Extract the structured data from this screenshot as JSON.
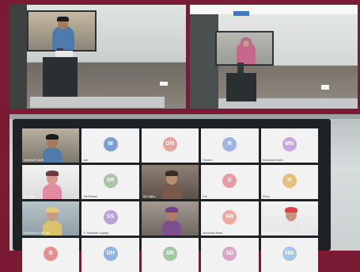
{
  "participants": [
    {
      "name": "MUHAJIR ALIM",
      "initials": "",
      "color": "",
      "video": true
    },
    {
      "name": "ann",
      "initials": "W",
      "color": "#7b9fd0",
      "video": false
    },
    {
      "name": "",
      "initials": "DM",
      "color": "#e8a39b",
      "video": false
    },
    {
      "name": "Romeo",
      "initials": "R",
      "color": "#9fb4e3",
      "video": false
    },
    {
      "name": "Muhd Amir Amin",
      "initials": "MN",
      "color": "#c6a7dc",
      "video": false
    },
    {
      "name": "Siti Hajar",
      "initials": "",
      "color": "",
      "video": true
    },
    {
      "name": "Siti Rohani",
      "initials": "SR",
      "color": "#aac4a6",
      "video": false
    },
    {
      "name": "Siti Jaliha",
      "initials": "",
      "color": "",
      "video": true
    },
    {
      "name": "Edi",
      "initials": "E",
      "color": "#e89aa2",
      "video": false
    },
    {
      "name": "Siti ai",
      "initials": "H",
      "color": "#e5c07b",
      "video": false
    },
    {
      "name": "NORAJIDA CHE MA",
      "initials": "",
      "color": "",
      "video": true
    },
    {
      "name": "S. Sabariah Supriyo",
      "initials": "SS",
      "color": "#b7a4d6",
      "video": false
    },
    {
      "name": "",
      "initials": "",
      "color": "",
      "video": true
    },
    {
      "name": "Noorniela Raha",
      "initials": "NR",
      "color": "#f0a7a1",
      "video": false
    },
    {
      "name": "NORHAFZA AMIR",
      "initials": "",
      "color": "",
      "video": true
    },
    {
      "name": "",
      "initials": "B",
      "color": "#e88e8e",
      "video": false
    },
    {
      "name": "",
      "initials": "DH",
      "color": "#8fb4e0",
      "video": false
    },
    {
      "name": "",
      "initials": "SR",
      "color": "#9ec9a3",
      "video": false
    },
    {
      "name": "",
      "initials": "SD",
      "color": "#d9a7c7",
      "video": false
    },
    {
      "name": "",
      "initials": "HM",
      "color": "#a7c7e7",
      "video": false
    }
  ]
}
